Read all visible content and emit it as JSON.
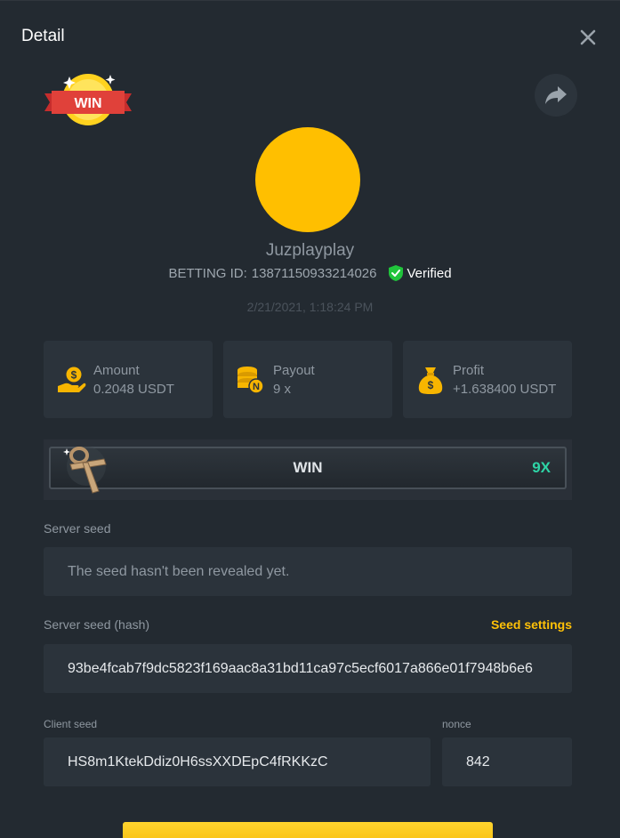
{
  "header": {
    "title": "Detail"
  },
  "player": {
    "username": "Juzplayplay",
    "betting_id_label": "BETTING ID:",
    "betting_id": "13871150933214026",
    "verified_label": "Verified",
    "date": "2/21/2021, 1:18:24 PM",
    "badge_text": "WIN"
  },
  "stats": [
    {
      "label": "Amount",
      "value": "0.2048 USDT",
      "icon": "hand-coin-icon"
    },
    {
      "label": "Payout",
      "value": "9 x",
      "icon": "coin-stack-icon"
    },
    {
      "label": "Profit",
      "value": "+1.638400 USDT",
      "icon": "money-bag-icon"
    }
  ],
  "result": {
    "outcome": "WIN",
    "multiplier": "9X"
  },
  "seeds": {
    "server_seed_label": "Server seed",
    "server_seed_value": "The seed hasn't been revealed yet.",
    "server_hash_label": "Server seed (hash)",
    "seed_settings_label": "Seed settings",
    "server_hash_value": "93be4fcab7f9dc5823f169aac8a31bd11ca97c5ecf6017a866e01f7948b6e6",
    "client_seed_label": "Client seed",
    "client_seed_value": "HS8m1KtekDdiz0H6ssXXDEpC4fRKKzC",
    "nonce_label": "nonce",
    "nonce_value": "842"
  },
  "colors": {
    "accent": "#ffc107",
    "win_multiplier": "#2ed4a6",
    "verified": "#20c43b",
    "avatar": "#ffbf00"
  }
}
